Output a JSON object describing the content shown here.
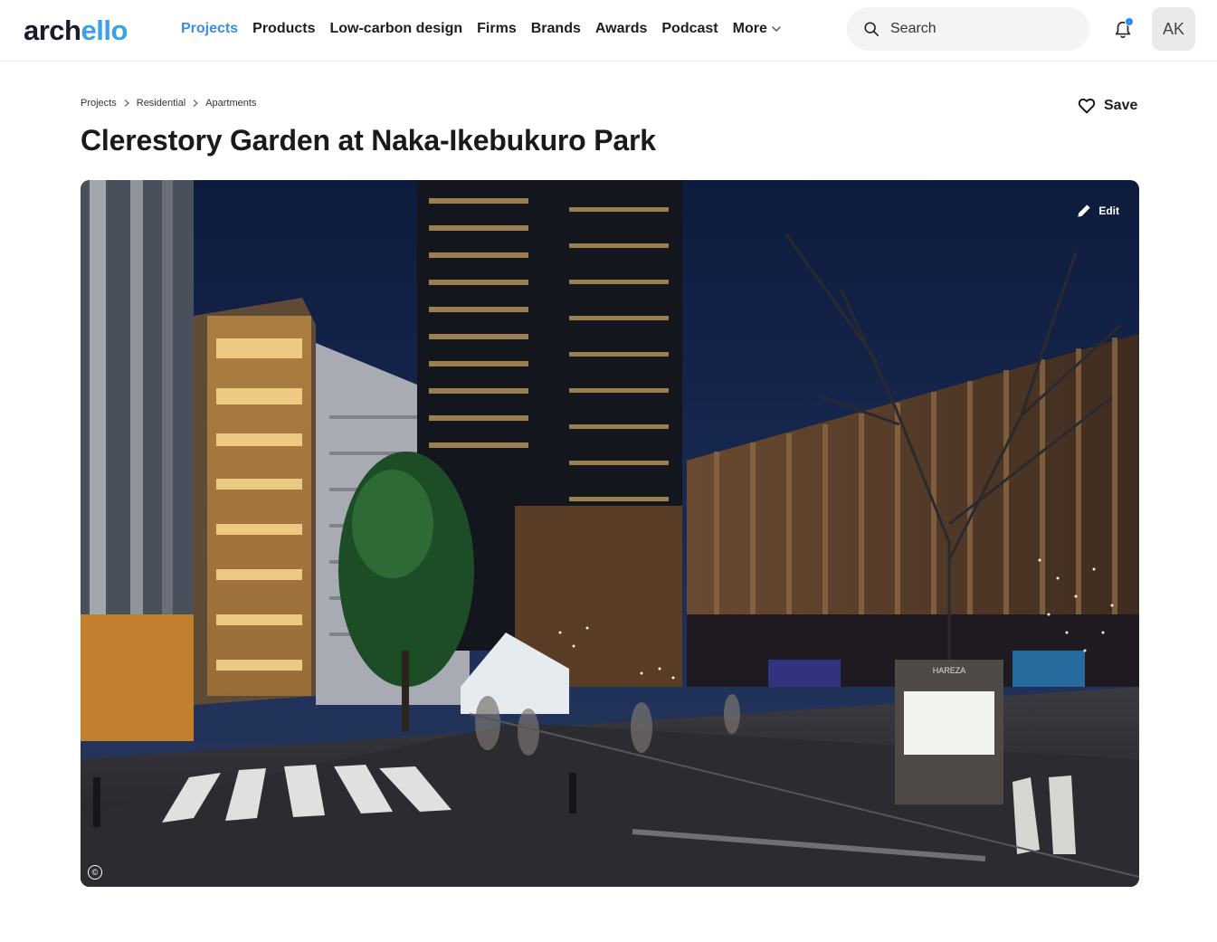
{
  "logo": {
    "part1": "arch",
    "part2": "ello"
  },
  "nav": {
    "items": [
      {
        "label": "Projects",
        "active": true
      },
      {
        "label": "Products"
      },
      {
        "label": "Low-carbon design"
      },
      {
        "label": "Firms"
      },
      {
        "label": "Brands"
      },
      {
        "label": "Awards"
      },
      {
        "label": "Podcast"
      }
    ],
    "more_label": "More"
  },
  "search": {
    "placeholder": "Search"
  },
  "user": {
    "initials": "AK"
  },
  "breadcrumb": [
    "Projects",
    "Residential",
    "Apartments"
  ],
  "save_label": "Save",
  "page_title": "Clerestory Garden at Naka-Ikebukuro Park",
  "hero": {
    "edit_label": "Edit",
    "copyright_symbol": "©"
  },
  "colors": {
    "accent": "#3a8ee6",
    "logo_dark": "#1a1a2e",
    "logo_light": "#3aa0e8",
    "notification_dot": "#2e8cf0"
  },
  "icons": [
    "search-icon",
    "bell-icon",
    "chevron-down-icon",
    "chevron-right-icon",
    "heart-icon",
    "pencil-icon",
    "copyright-icon"
  ]
}
